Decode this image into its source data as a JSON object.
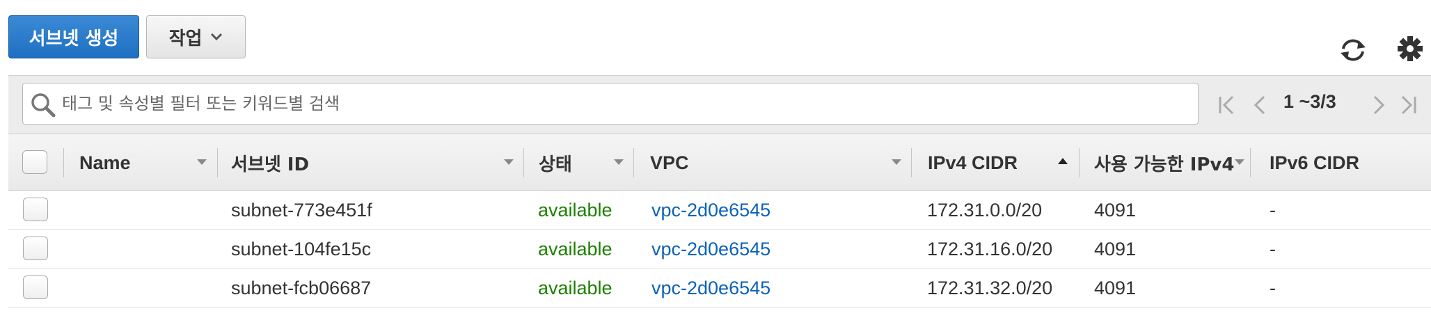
{
  "toolbar": {
    "create_label": "서브넷 생성",
    "actions_label": "작업"
  },
  "filter": {
    "placeholder": "태그 및 속성별 필터 또는 키워드별 검색"
  },
  "pagination": {
    "range_text": "1 ~3/3"
  },
  "table": {
    "columns": [
      "Name",
      "서브넷 ID",
      "상태",
      "VPC",
      "IPv4 CIDR",
      "사용 가능한 IPv4",
      "IPv6 CIDR"
    ],
    "sorted_column": "IPv4 CIDR",
    "sort_direction": "ascending",
    "rows": [
      {
        "name": "",
        "subnet_id": "subnet-773e451f",
        "state": "available",
        "vpc": "vpc-2d0e6545",
        "ipv4_cidr": "172.31.0.0/20",
        "available_ipv4": "4091",
        "ipv6_cidr": "-"
      },
      {
        "name": "",
        "subnet_id": "subnet-104fe15c",
        "state": "available",
        "vpc": "vpc-2d0e6545",
        "ipv4_cidr": "172.31.16.0/20",
        "available_ipv4": "4091",
        "ipv6_cidr": "-"
      },
      {
        "name": "",
        "subnet_id": "subnet-fcb06687",
        "state": "available",
        "vpc": "vpc-2d0e6545",
        "ipv4_cidr": "172.31.32.0/20",
        "available_ipv4": "4091",
        "ipv6_cidr": "-"
      }
    ]
  },
  "icons": {
    "actions": "chevron-down-icon",
    "refresh": "refresh-icon",
    "settings": "gear-icon",
    "search": "search-icon",
    "pager": [
      "first-page-icon",
      "prev-page-icon",
      "next-page-icon",
      "last-page-icon"
    ]
  },
  "colors": {
    "primary_button": "#1f6fc2",
    "state_available": "#1d8102",
    "link": "#0a62b8"
  }
}
